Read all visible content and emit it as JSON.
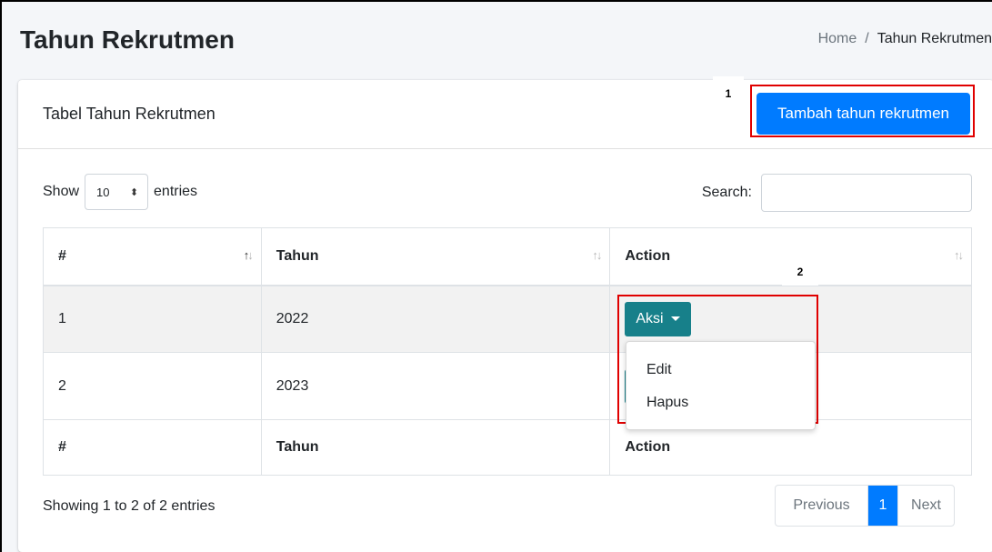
{
  "header": {
    "title": "Tahun Rekrutmen",
    "breadcrumb": {
      "home": "Home",
      "separator": "/",
      "current": "Tahun Rekrutmen"
    }
  },
  "card": {
    "title": "Tabel Tahun Rekrutmen",
    "add_button_label": "Tambah tahun rekrutmen"
  },
  "annotations": {
    "one": "1",
    "two": "2"
  },
  "datatable": {
    "show_label": "Show",
    "page_length": "10",
    "entries_label": "entries",
    "search_label": "Search:",
    "search_value": "",
    "columns": [
      "#",
      "Tahun",
      "Action"
    ],
    "rows": [
      {
        "no": "1",
        "tahun": "2022"
      },
      {
        "no": "2",
        "tahun": "2023"
      }
    ],
    "action_button_label": "Aksi",
    "dropdown_items": [
      "Edit",
      "Hapus"
    ],
    "info": "Showing 1 to 2 of 2 entries",
    "pagination": {
      "previous": "Previous",
      "current_page": "1",
      "next": "Next"
    }
  },
  "colors": {
    "primary": "#007bff",
    "action_button": "#17808a",
    "annotation": "#e00000",
    "page_bg": "#f4f6f9"
  }
}
